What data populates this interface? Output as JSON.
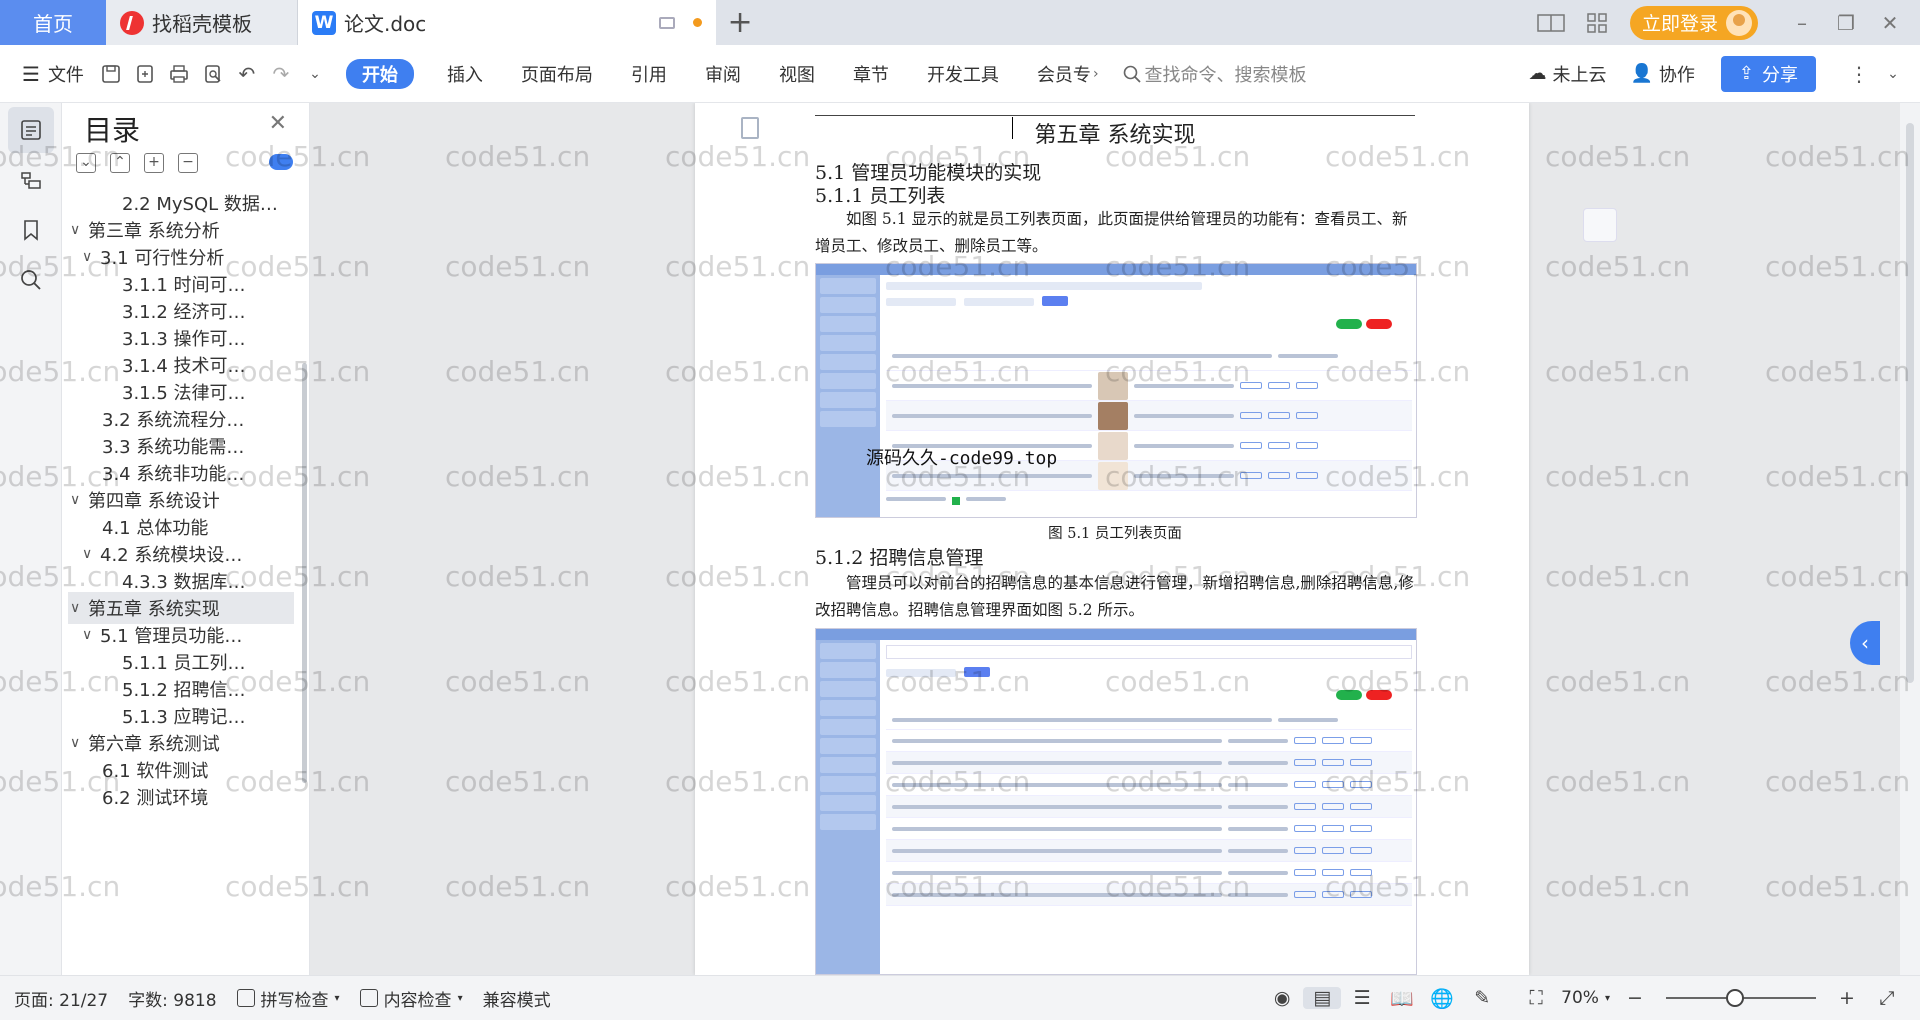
{
  "tabs": {
    "home": "首页",
    "daoke": "找稻壳模板",
    "doc": "论文.doc",
    "new_tab": "+"
  },
  "titlebar": {
    "login": "立即登录",
    "minimize": "–",
    "restore": "❐",
    "close": "✕"
  },
  "ribbon": {
    "file_menu": "文件",
    "tabs": [
      "开始",
      "插入",
      "页面布局",
      "引用",
      "审阅",
      "视图",
      "章节",
      "开发工具",
      "会员专"
    ],
    "search_placeholder": "查找命令、搜索模板",
    "cloud": "未上云",
    "collab": "协作",
    "share": "分享"
  },
  "toc": {
    "title": "目录",
    "items": [
      {
        "label": "2.2 MySQL 数据…",
        "level": 2,
        "chev": ""
      },
      {
        "label": "第三章  系统分析",
        "level": 0,
        "chev": "∨"
      },
      {
        "label": "3.1 可行性分析",
        "level": 1,
        "chev": "∨"
      },
      {
        "label": "3.1.1 时间可…",
        "level": 2,
        "chev": ""
      },
      {
        "label": "3.1.2  经济可…",
        "level": 2,
        "chev": ""
      },
      {
        "label": "3.1.3  操作可…",
        "level": 2,
        "chev": ""
      },
      {
        "label": "3.1.4  技术可…",
        "level": 2,
        "chev": ""
      },
      {
        "label": "3.1.5  法律可…",
        "level": 2,
        "chev": ""
      },
      {
        "label": "3.2 系统流程分…",
        "level": 1,
        "chev": ""
      },
      {
        "label": "3.3 系统功能需…",
        "level": 1,
        "chev": ""
      },
      {
        "label": "3.4  系统非功能…",
        "level": 1,
        "chev": ""
      },
      {
        "label": "第四章  系统设计",
        "level": 0,
        "chev": "∨"
      },
      {
        "label": "4.1  总体功能",
        "level": 1,
        "chev": ""
      },
      {
        "label": "4.2  系统模块设…",
        "level": 1,
        "chev": "∨"
      },
      {
        "label": "4.3.3  数据库…",
        "level": 2,
        "chev": ""
      },
      {
        "label": "第五章  系统实现",
        "level": 0,
        "chev": "∨",
        "selected": true
      },
      {
        "label": "5.1  管理员功能…",
        "level": 1,
        "chev": "∨"
      },
      {
        "label": "5.1.1  员工列…",
        "level": 2,
        "chev": ""
      },
      {
        "label": "5.1.2  招聘信…",
        "level": 2,
        "chev": ""
      },
      {
        "label": "5.1.3  应聘记…",
        "level": 2,
        "chev": ""
      },
      {
        "label": "第六章  系统测试",
        "level": 0,
        "chev": "∨"
      },
      {
        "label": "6.1 软件测试",
        "level": 1,
        "chev": ""
      },
      {
        "label": "6.2 测试环境",
        "level": 1,
        "chev": ""
      }
    ]
  },
  "document": {
    "chapter_title": "第五章  系统实现",
    "h_5_1": "5.1  管理员功能模块的实现",
    "h_5_1_1": "5.1.1  员工列表",
    "p1": "如图 5.1 显示的就是员工列表页面，此页面提供给管理员的功能有：查看员工、新增员工、修改员工、删除员工等。",
    "caption1": "图 5.1  员工列表页面",
    "h_5_1_2": "5.1.2  招聘信息管理",
    "p2": "管理员可以对前台的招聘信息的基本信息进行管理，新增招聘信息,删除招聘信息,修改招聘信息。招聘信息管理界面如图 5.2 所示。",
    "shot_watermark": "源码久久-code99.top"
  },
  "watermark_text": "code51.cn",
  "status": {
    "page": "页面: 21/27",
    "words": "字数: 9818",
    "spell": "拼写检查",
    "content_check": "内容检查",
    "compat": "兼容模式",
    "zoom": "70%",
    "zoom_level": 0.7
  },
  "colors": {
    "accent": "#3f7ff0",
    "login": "#f5a623",
    "home_tab": "#5b8def"
  }
}
